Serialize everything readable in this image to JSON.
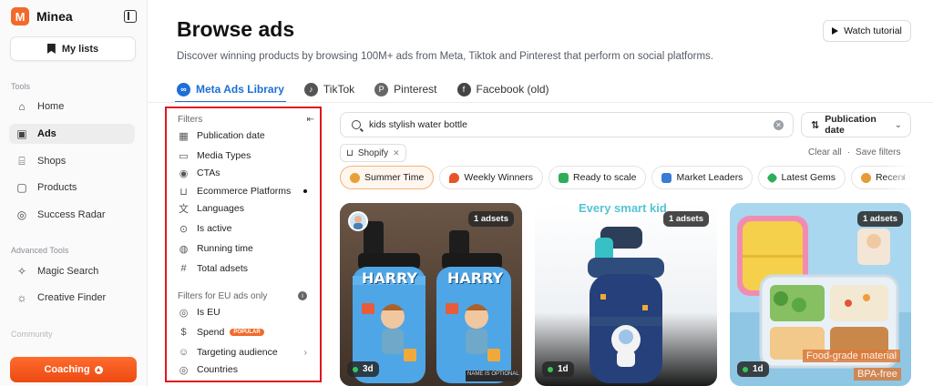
{
  "app": {
    "name": "Minea",
    "logo_letter": "M"
  },
  "sidebar": {
    "my_lists": "My lists",
    "sections": {
      "tools": "Tools",
      "advanced": "Advanced Tools",
      "community": "Community"
    },
    "tools": [
      {
        "label": "Home",
        "icon": "home-icon",
        "active": false
      },
      {
        "label": "Ads",
        "icon": "ads-icon",
        "active": true
      },
      {
        "label": "Shops",
        "icon": "shop-icon",
        "active": false
      },
      {
        "label": "Products",
        "icon": "product-icon",
        "active": false
      },
      {
        "label": "Success Radar",
        "icon": "radar-icon",
        "active": false
      }
    ],
    "advanced": [
      {
        "label": "Magic Search",
        "icon": "wand-icon"
      },
      {
        "label": "Creative Finder",
        "icon": "spark-icon"
      }
    ],
    "coaching": "Coaching"
  },
  "header": {
    "title": "Browse ads",
    "subtitle": "Discover winning products by browsing 100M+ ads from Meta, Tiktok and Pinterest that perform on social platforms.",
    "watch_tutorial": "Watch tutorial"
  },
  "tabs": [
    {
      "label": "Meta Ads Library",
      "active": true,
      "icon_color": "#1d6fd6"
    },
    {
      "label": "TikTok",
      "active": false,
      "icon_color": "#222222"
    },
    {
      "label": "Pinterest",
      "active": false,
      "icon_color": "#555555"
    },
    {
      "label": "Facebook (old)",
      "active": false,
      "icon_color": "#222222"
    }
  ],
  "filters": {
    "title": "Filters",
    "items": [
      {
        "label": "Publication date",
        "icon": "calendar-icon"
      },
      {
        "label": "Media Types",
        "icon": "video-icon"
      },
      {
        "label": "CTAs",
        "icon": "cursor-icon"
      },
      {
        "label": "Ecommerce Platforms",
        "icon": "cart-icon",
        "dot": true
      },
      {
        "label": "Languages",
        "icon": "translate-icon"
      },
      {
        "label": "Is active",
        "icon": "active-icon"
      },
      {
        "label": "Running time",
        "icon": "eye-icon"
      },
      {
        "label": "Total adsets",
        "icon": "hash-icon"
      }
    ],
    "eu_title": "Filters for EU ads only",
    "eu_items": [
      {
        "label": "Is EU",
        "icon": "globe-icon"
      },
      {
        "label": "Spend",
        "icon": "dollar-icon",
        "badge": "POPULAR"
      },
      {
        "label": "Targeting audience",
        "icon": "person-icon",
        "chevron": true
      },
      {
        "label": "Countries",
        "icon": "globe-icon"
      }
    ]
  },
  "search": {
    "value": "kids stylish water bottle",
    "sort_label": "Publication date"
  },
  "active_filter_chip": "Shopify",
  "actions": {
    "clear_all": "Clear all",
    "separator": "·",
    "save_filters": "Save filters"
  },
  "quick_filters": [
    {
      "label": "Summer Time",
      "active": true,
      "icon_color": "#e8a035"
    },
    {
      "label": "Weekly Winners",
      "active": false,
      "icon_color": "#e8532a"
    },
    {
      "label": "Ready to scale",
      "active": false,
      "icon_color": "#2fae5a"
    },
    {
      "label": "Market Leaders",
      "active": false,
      "icon_color": "#3a7bd5"
    },
    {
      "label": "Latest Gems",
      "active": false,
      "icon_color": "#2fae5a"
    },
    {
      "label": "Recent dropshipping",
      "active": false,
      "icon_color": "#e89a35"
    }
  ],
  "ads": [
    {
      "adsets": "1 adsets",
      "age": "3d",
      "bottle_text": "HARRY",
      "footer_text": "NAME IS OPTIONAL"
    },
    {
      "adsets": "1 adsets",
      "age": "1d",
      "headline": "Every smart kid"
    },
    {
      "adsets": "1 adsets",
      "age": "1d",
      "overlay_1": "Food-grade material",
      "overlay_2": "BPA-free"
    }
  ]
}
